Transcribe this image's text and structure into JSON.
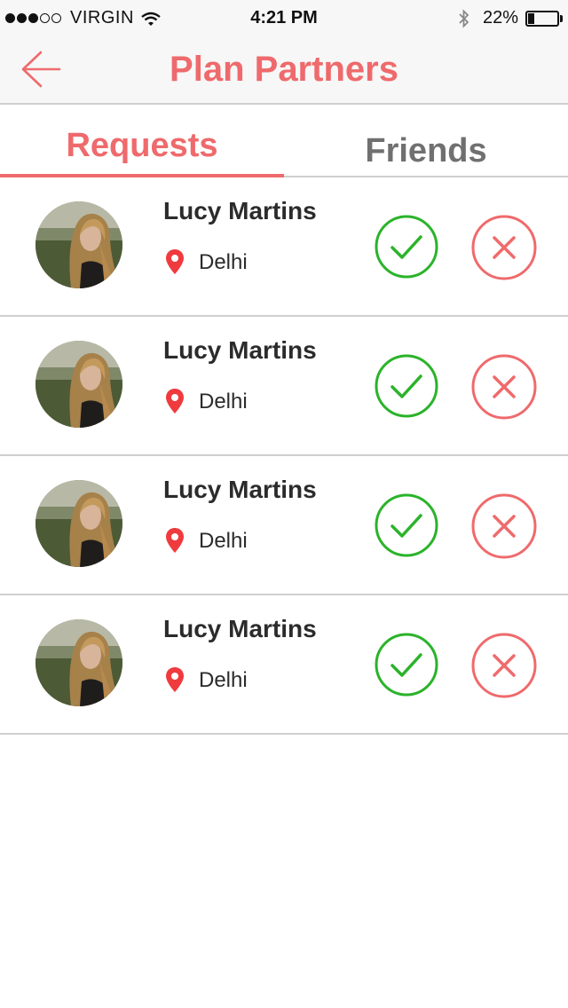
{
  "status_bar": {
    "carrier": "VIRGIN",
    "time": "4:21 PM",
    "battery_percent": "22%",
    "battery_level": 0.22,
    "signal_bars_filled": 3,
    "signal_bars_total": 5
  },
  "nav": {
    "title": "Plan Partners",
    "back_icon": "arrow-left-icon"
  },
  "tabs": [
    {
      "label": "Requests",
      "active": true
    },
    {
      "label": "Friends",
      "active": false
    }
  ],
  "requests": [
    {
      "name": "Lucy Martins",
      "city": "Delhi"
    },
    {
      "name": "Lucy Martins",
      "city": "Delhi"
    },
    {
      "name": "Lucy Martins",
      "city": "Delhi"
    },
    {
      "name": "Lucy Martins",
      "city": "Delhi"
    }
  ],
  "colors": {
    "accent": "#ef6a6c",
    "accept": "#2bb32a",
    "reject": "#ef6a6c",
    "inactive_tab": "#707070"
  }
}
